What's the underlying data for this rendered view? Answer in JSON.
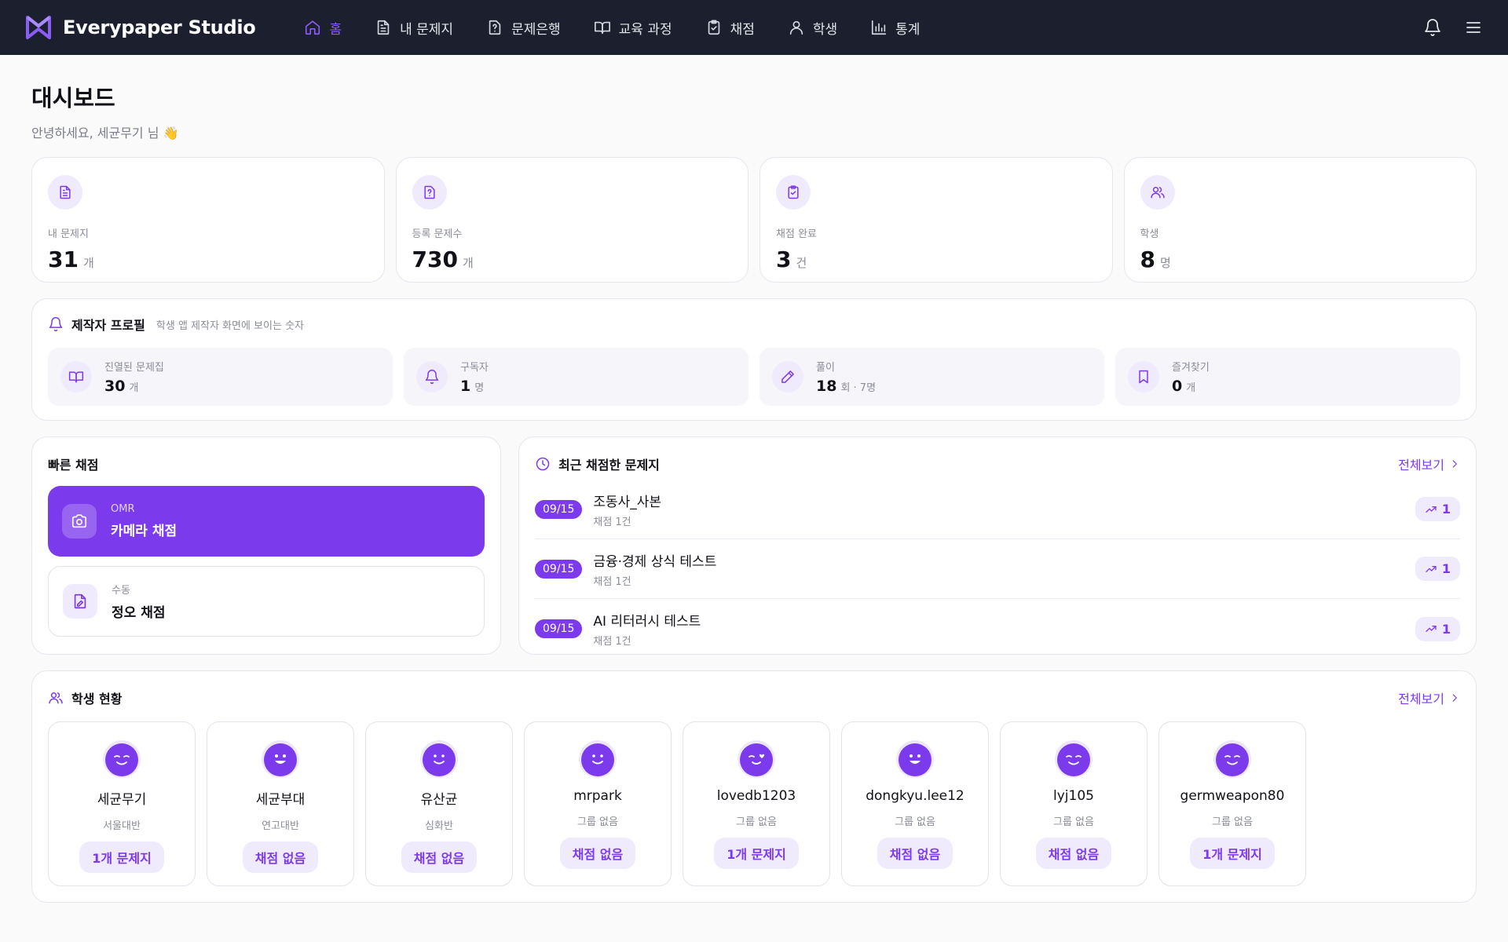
{
  "brand": {
    "name": "Everypaper Studio",
    "accent": "#7c3aed",
    "nav_bg": "#1b1f2e"
  },
  "nav": [
    {
      "label": "홈",
      "icon": "home-icon",
      "active": true
    },
    {
      "label": "내 문제지",
      "icon": "document-icon"
    },
    {
      "label": "문제은행",
      "icon": "question-file-icon"
    },
    {
      "label": "교육 과정",
      "icon": "open-book-icon"
    },
    {
      "label": "채점",
      "icon": "clipboard-check-icon"
    },
    {
      "label": "학생",
      "icon": "user-icon"
    },
    {
      "label": "통계",
      "icon": "bar-chart-icon"
    }
  ],
  "header": {
    "title": "대시보드",
    "greeting": "안녕하세요, 세균무기 님 👋"
  },
  "stats": [
    {
      "label": "내 문제지",
      "value": "31",
      "unit": "개",
      "icon": "document-icon"
    },
    {
      "label": "등록 문제수",
      "value": "730",
      "unit": "개",
      "icon": "question-file-icon"
    },
    {
      "label": "채점 완료",
      "value": "3",
      "unit": "건",
      "icon": "clipboard-check-icon"
    },
    {
      "label": "학생",
      "value": "8",
      "unit": "명",
      "icon": "users-icon"
    }
  ],
  "profile": {
    "title": "제작자 프로필",
    "note": "학생 앱 제작자 화면에 보이는 숫자",
    "items": [
      {
        "label": "진열된 문제집",
        "value": "30",
        "unit": "개",
        "icon": "open-book-icon"
      },
      {
        "label": "구독자",
        "value": "1",
        "unit": "명",
        "icon": "bell-icon"
      },
      {
        "label": "풀이",
        "value": "18",
        "unit": "회 · 7명",
        "icon": "pencil-icon"
      },
      {
        "label": "즐겨찾기",
        "value": "0",
        "unit": "개",
        "icon": "bookmark-icon"
      }
    ]
  },
  "quick_grading": {
    "title": "빠른 채점",
    "primary": {
      "small": "OMR",
      "big": "카메라 채점",
      "icon": "camera-icon"
    },
    "secondary": {
      "small": "수동",
      "big": "정오 채점",
      "icon": "file-edit-icon"
    }
  },
  "recent": {
    "title": "최근 채점한 문제지",
    "see_all": "전체보기",
    "items": [
      {
        "date": "09/15",
        "name": "조동사_사본",
        "count": "채점 1건",
        "trend": "1"
      },
      {
        "date": "09/15",
        "name": "금융·경제 상식 테스트",
        "count": "채점 1건",
        "trend": "1"
      },
      {
        "date": "09/15",
        "name": "AI 리터러시 테스트",
        "count": "채점 1건",
        "trend": "1"
      }
    ]
  },
  "students": {
    "title": "학생 현황",
    "see_all": "전체보기",
    "items": [
      {
        "name": "세균무기",
        "group": "서울대반",
        "badge": "1개 문제지",
        "face": "wink"
      },
      {
        "name": "세균부대",
        "group": "연고대반",
        "badge": "채점 없음",
        "face": "grin"
      },
      {
        "name": "유산균",
        "group": "심화반",
        "badge": "채점 없음",
        "face": "smile"
      },
      {
        "name": "mrpark",
        "group": "그룹 없음",
        "badge": "채점 없음",
        "face": "smile"
      },
      {
        "name": "lovedb1203",
        "group": "그룹 없음",
        "badge": "1개 문제지",
        "face": "love"
      },
      {
        "name": "dongkyu.lee12",
        "group": "그룹 없음",
        "badge": "채점 없음",
        "face": "grin"
      },
      {
        "name": "lyj105",
        "group": "그룹 없음",
        "badge": "채점 없음",
        "face": "wink"
      },
      {
        "name": "germweapon80",
        "group": "그룹 없음",
        "badge": "1개 문제지",
        "face": "wink"
      }
    ]
  }
}
